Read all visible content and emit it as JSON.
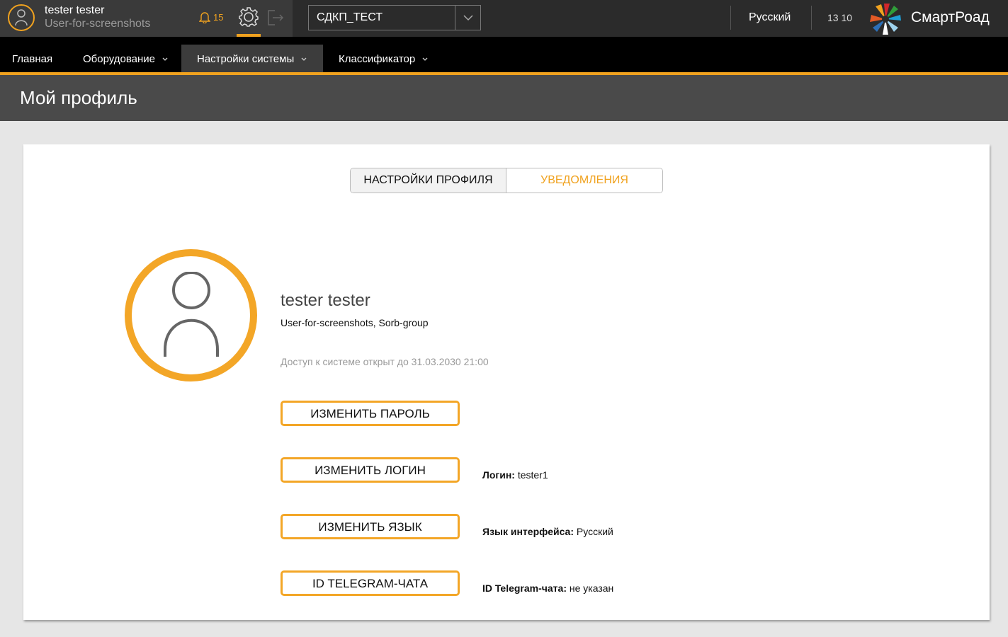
{
  "user": {
    "name": "tester tester",
    "subtitle": "User-for-screenshots"
  },
  "header": {
    "notifications_count": "15",
    "project": "СДКП_ТЕСТ",
    "language": "Русский",
    "time": "13 10",
    "brand": "СмартРоад"
  },
  "nav": {
    "items": [
      {
        "label": "Главная"
      },
      {
        "label": "Оборудование"
      },
      {
        "label": "Настройки системы"
      },
      {
        "label": "Классификатор"
      }
    ]
  },
  "page": {
    "title": "Мой профиль"
  },
  "tabs": [
    {
      "label": "НАСТРОЙКИ ПРОФИЛЯ"
    },
    {
      "label": "УВЕДОМЛЕНИЯ"
    }
  ],
  "profile": {
    "name": "tester tester",
    "org": "User-for-screenshots, Sorb-group",
    "access": "Доступ к системе открыт до 31.03.2030 21:00"
  },
  "actions": {
    "change_password": "ИЗМЕНИТЬ ПАРОЛЬ",
    "change_login": "ИЗМЕНИТЬ ЛОГИН",
    "change_language": "ИЗМЕНИТЬ ЯЗЫК",
    "telegram": "ID TELEGRAM-ЧАТА"
  },
  "info": {
    "login_label": "Логин:",
    "login_value": " tester1",
    "lang_label": "Язык интерфейса:",
    "lang_value": " Русский",
    "telegram_label": "ID Telegram-чата:",
    "telegram_value": " не указан"
  },
  "colors": {
    "accent": "#f0a21f",
    "topbar": "#2b2b2b",
    "navbar": "#000000",
    "titlebar": "#4a4a4a"
  }
}
